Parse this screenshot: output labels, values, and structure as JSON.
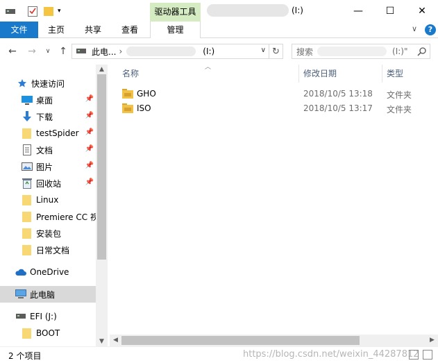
{
  "title_bar": {
    "context_tab": "驱动器工具",
    "title_suffix": "(I:)",
    "minimize": "—",
    "maximize": "☐",
    "close": "✕"
  },
  "ribbon": {
    "file_tab": "文件",
    "tabs": [
      "主页",
      "共享",
      "查看"
    ],
    "manage_tab": "管理",
    "collapse": "∨",
    "help": "?"
  },
  "address_bar": {
    "back": "←",
    "forward": "→",
    "recent": "∨",
    "up": "↑",
    "path_root": "此电...",
    "path_sep": "›",
    "path_suffix": "(I:)",
    "dropdown": "∨",
    "refresh": "↻"
  },
  "search": {
    "placeholder_prefix": "搜索",
    "placeholder_suffix": "(I:)\""
  },
  "sidebar": {
    "quick_access": "快速访问",
    "items": [
      {
        "label": "桌面",
        "icon": "desktop-icon",
        "pinned": true
      },
      {
        "label": "下载",
        "icon": "download-icon",
        "pinned": true
      },
      {
        "label": "testSpider",
        "icon": "folder-icon",
        "pinned": true
      },
      {
        "label": "文档",
        "icon": "document-icon",
        "pinned": true
      },
      {
        "label": "图片",
        "icon": "picture-icon",
        "pinned": true
      },
      {
        "label": "回收站",
        "icon": "recycle-bin-icon",
        "pinned": true
      },
      {
        "label": "Linux",
        "icon": "folder-icon",
        "pinned": false
      },
      {
        "label": "Premiere CC 视",
        "icon": "folder-icon",
        "pinned": false
      },
      {
        "label": "安装包",
        "icon": "folder-icon",
        "pinned": false
      },
      {
        "label": "日常文档",
        "icon": "folder-icon",
        "pinned": false
      }
    ],
    "onedrive": "OneDrive",
    "this_pc": "此电脑",
    "efi": "EFI (J:)",
    "boot": "BOOT"
  },
  "columns": {
    "name": "名称",
    "date": "修改日期",
    "type": "类型"
  },
  "files": [
    {
      "name": "GHO",
      "date": "2018/10/5 13:18",
      "type": "文件夹"
    },
    {
      "name": "ISO",
      "date": "2018/10/5 13:17",
      "type": "文件夹"
    }
  ],
  "status": {
    "count": "2 个项目",
    "watermark": "https://blog.csdn.net/weixin_44287812"
  },
  "colors": {
    "accent": "#1979ca",
    "context_tab": "#d5ecc3",
    "folder": "#f5c542",
    "selected": "#d9d9d9"
  }
}
